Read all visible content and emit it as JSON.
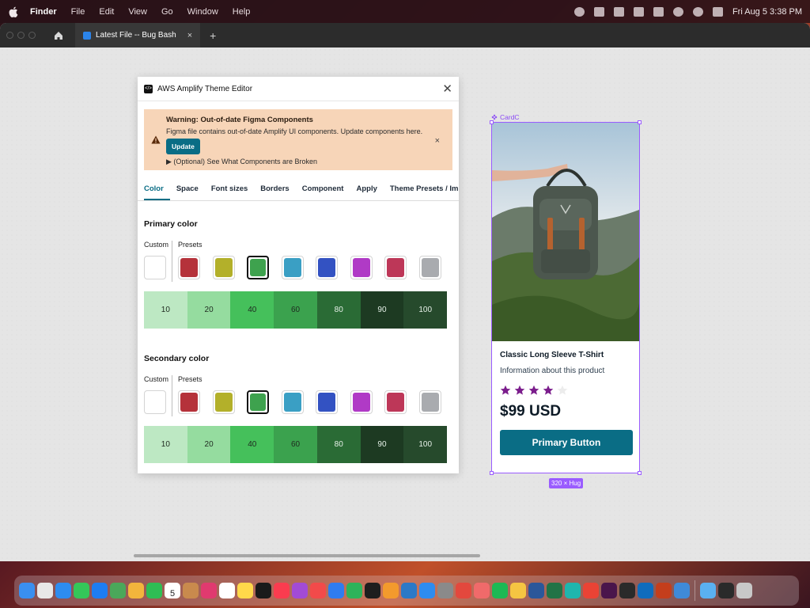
{
  "menubar": {
    "app_name": "Finder",
    "menus": [
      "File",
      "Edit",
      "View",
      "Go",
      "Window",
      "Help"
    ],
    "clock": "Fri Aug 5  3:38 PM"
  },
  "tabbar": {
    "doc_tab_label": "Latest File -- Bug Bash",
    "close_glyph": "×",
    "new_tab_glyph": "+"
  },
  "plugin": {
    "title": "AWS Amplify Theme Editor",
    "logo_glyph": "</>",
    "close_glyph": "✕",
    "alert": {
      "title": "Warning: Out-of-date Figma Components",
      "body": "Figma file contains out-of-date Amplify UI components. Update components here.",
      "button": "Update",
      "details": "▶ (Optional) See What Components are Broken",
      "dismiss_glyph": "×"
    },
    "tabs": [
      "Color",
      "Space",
      "Font sizes",
      "Borders",
      "Component",
      "Apply",
      "Theme Presets / Import"
    ],
    "active_tab": "Color",
    "primary": {
      "title": "Primary color",
      "custom_label": "Custom",
      "presets_label": "Presets",
      "selected_index": 2
    },
    "secondary": {
      "title": "Secondary color",
      "custom_label": "Custom",
      "presets_label": "Presets",
      "selected_index": 2
    },
    "preset_colors": [
      "#b5323a",
      "#b3b02a",
      "#3ea24e",
      "#3a9fc4",
      "#3352c2",
      "#b03ac6",
      "#bd3758",
      "#a9abaf"
    ],
    "scale": {
      "labels": [
        "10",
        "20",
        "40",
        "60",
        "80",
        "90",
        "100"
      ],
      "colors": [
        "#bde8c3",
        "#95dc9f",
        "#45c05b",
        "#3ba24e",
        "#2a6b35",
        "#1d3a22",
        "#264a2c"
      ]
    }
  },
  "card": {
    "component_label": "CardC",
    "title": "Classic Long Sleeve T-Shirt",
    "description": "Information about this product",
    "rating": 4,
    "rating_max": 5,
    "price": "$99 USD",
    "button": "Primary Button",
    "size_badge": "320 × Hug"
  },
  "colors": {
    "accent": "#0a6d85",
    "star": "#7b1d8c",
    "selection": "#9a5cff"
  },
  "dock": {
    "apps": [
      "finder-icon",
      "launchpad-icon",
      "safari-icon",
      "messages-icon",
      "mail-icon",
      "maps-icon",
      "photos-icon",
      "facetime-icon",
      "calendar-icon",
      "stickies-icon",
      "intellij-icon",
      "reminders-icon",
      "notes-icon",
      "appletv-icon",
      "music-icon",
      "podcasts-icon",
      "news-icon",
      "keynote-icon",
      "numbers-icon",
      "figma-icon",
      "pages-icon",
      "vscode-icon",
      "appstore-icon",
      "system-preferences-icon",
      "todoist-icon",
      "asana-icon",
      "spotify-icon",
      "chrome-canary-icon",
      "word-icon",
      "excel-icon",
      "perplexity-icon",
      "chrome-icon",
      "slack-icon",
      "terminal-icon",
      "outlook-icon",
      "powerpoint-icon",
      "preview-icon",
      "folder-icon",
      "screen-icon",
      "trash-icon"
    ],
    "calendar_day": "5"
  }
}
